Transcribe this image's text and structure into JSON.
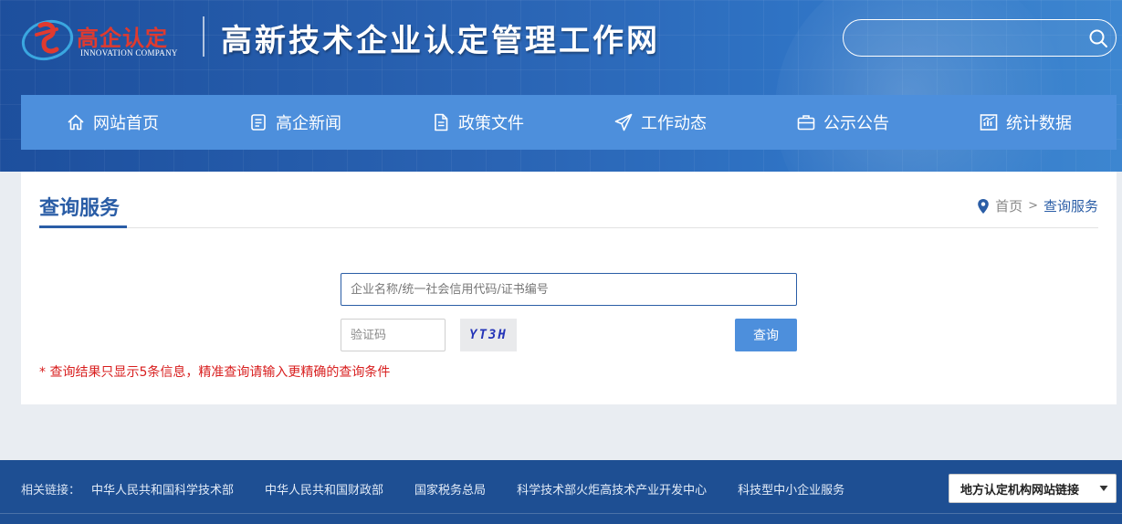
{
  "header": {
    "logo_cn": "高企认定",
    "logo_en": "INNOVATION COMPANY",
    "site_title": "高新技术企业认定管理工作网",
    "search": {
      "value": "",
      "placeholder": ""
    },
    "search_icon": "search-icon"
  },
  "nav": {
    "items": [
      {
        "label": "网站首页",
        "icon": "home-icon"
      },
      {
        "label": "高企新闻",
        "icon": "news-icon"
      },
      {
        "label": "政策文件",
        "icon": "document-icon"
      },
      {
        "label": "工作动态",
        "icon": "paper-plane-icon"
      },
      {
        "label": "公示公告",
        "icon": "briefcase-icon"
      },
      {
        "label": "统计数据",
        "icon": "chart-icon"
      }
    ]
  },
  "main": {
    "page_title": "查询服务",
    "breadcrumb": {
      "home": "首页",
      "separator": ">",
      "current": "查询服务"
    },
    "query_input": {
      "value": "",
      "placeholder": "企业名称/统一社会信用代码/证书编号"
    },
    "captcha_input": {
      "value": "",
      "placeholder": "验证码"
    },
    "captcha_code": "YT3H",
    "query_button": "查询",
    "hint": "* 查询结果只显示5条信息，精准查询请输入更精确的查询条件"
  },
  "footer": {
    "links_label": "相关链接：",
    "links": [
      "中华人民共和国科学技术部",
      "中华人民共和国财政部",
      "国家税务总局",
      "科学技术部火炬高技术产业开发中心",
      "科技型中小企业服务"
    ],
    "local_select": "地方认定机构网站链接"
  },
  "colors": {
    "header_blue": "#2a64b4",
    "nav_blue": "#4d8fdc",
    "title_blue": "#2a5da6",
    "hint_red": "#d81e1e",
    "footer_blue": "#1e4f93",
    "logo_red": "#e03a2f"
  }
}
